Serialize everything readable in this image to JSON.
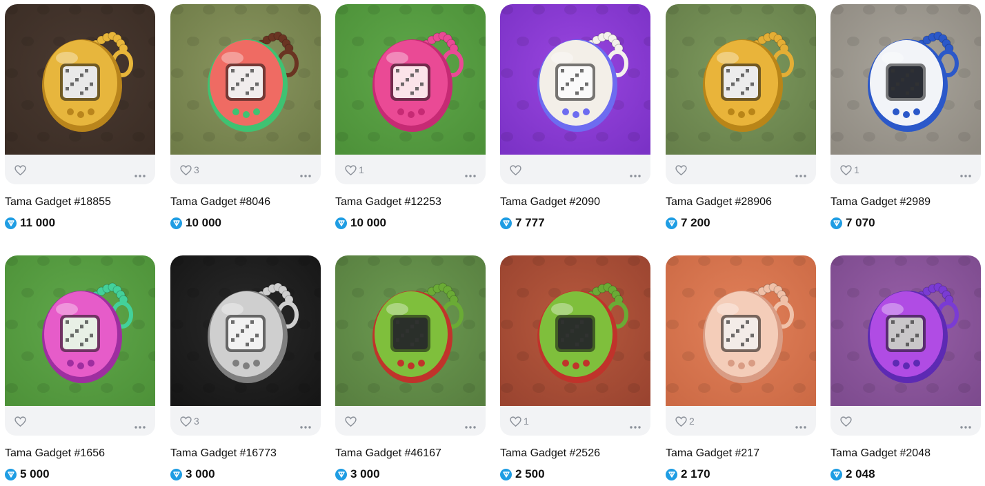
{
  "items": [
    {
      "title": "Tama Gadget #18855",
      "price": "11 000",
      "likes": "",
      "bg": "#4a3a31",
      "bg2": "#3b2d25",
      "body": "#e7b63d",
      "rim": "#b9851c",
      "screen": "#e9e9e9",
      "beads": "#e8b63a",
      "icon": "gadget-gold-icon"
    },
    {
      "title": "Tama Gadget #8046",
      "price": "10 000",
      "likes": "3",
      "bg": "#8a9660",
      "bg2": "#6f7c48",
      "body": "#ef6b63",
      "rim": "#3fc272",
      "screen": "#f1eded",
      "beads": "#6a3422",
      "icon": "gadget-red-green-icon"
    },
    {
      "title": "Tama Gadget #12253",
      "price": "10 000",
      "likes": "1",
      "bg": "#5fa84a",
      "bg2": "#4d9139",
      "body": "#ea4a95",
      "rim": "#c62a74",
      "screen": "#fbe3e9",
      "beads": "#ea4a95",
      "icon": "gadget-pink-heart-icon"
    },
    {
      "title": "Tama Gadget #2090",
      "price": "7 777",
      "likes": "",
      "bg": "#9a46e0",
      "bg2": "#7b32c6",
      "body": "#f3efe8",
      "rim": "#6d6cf0",
      "screen": "#fafafa",
      "beads": "#f4f1ec",
      "icon": "gadget-rainbow-icon"
    },
    {
      "title": "Tama Gadget #28906",
      "price": "7 200",
      "likes": "",
      "bg": "#7e9a5e",
      "bg2": "#667f4a",
      "body": "#e9b43a",
      "rim": "#b98518",
      "screen": "#ececec",
      "beads": "#e4ae35",
      "icon": "gadget-gold-icon"
    },
    {
      "title": "Tama Gadget #2989",
      "price": "7 070",
      "likes": "1",
      "bg": "#a9a59c",
      "bg2": "#908b82",
      "body": "#f2f4f8",
      "rim": "#2b58c9",
      "screen": "#2a2d35",
      "beads": "#2b58c9",
      "icon": "gadget-robot-icon"
    },
    {
      "title": "Tama Gadget #1656",
      "price": "5 000",
      "likes": "",
      "bg": "#60a84b",
      "bg2": "#4e9239",
      "body": "#e65cc9",
      "rim": "#9e2ea0",
      "screen": "#e8f0e6",
      "beads": "#43d19a",
      "icon": "gadget-pink-mint-icon"
    },
    {
      "title": "Tama Gadget #16773",
      "price": "3 000",
      "likes": "3",
      "bg": "#2a2a2a",
      "bg2": "#161616",
      "body": "#cfcfcf",
      "rim": "#7f7f7f",
      "screen": "#f2f2f2",
      "beads": "#cfcfcf",
      "icon": "gadget-silver-icon"
    },
    {
      "title": "Tama Gadget #46167",
      "price": "3 000",
      "likes": "",
      "bg": "#6d9c52",
      "bg2": "#587f40",
      "body": "#7fbf3c",
      "rim": "#c0332b",
      "screen": "#2a2f2a",
      "beads": "#6aab35",
      "icon": "gadget-frog-icon"
    },
    {
      "title": "Tama Gadget #2526",
      "price": "2 500",
      "likes": "1",
      "bg": "#b85a3e",
      "bg2": "#9a4430",
      "body": "#7fbf3c",
      "rim": "#c0332b",
      "screen": "#2a2f2a",
      "beads": "#6aab35",
      "icon": "gadget-frog-icon"
    },
    {
      "title": "Tama Gadget #217",
      "price": "2 170",
      "likes": "2",
      "bg": "#e2815a",
      "bg2": "#cc6a45",
      "body": "#f4cdb9",
      "rim": "#d99c84",
      "screen": "#f3ece8",
      "beads": "#f0c1a9",
      "icon": "gadget-peach-icon"
    },
    {
      "title": "Tama Gadget #2048",
      "price": "2 048",
      "likes": "",
      "bg": "#9860a8",
      "bg2": "#7d4b8e",
      "body": "#b04ce4",
      "rim": "#5d2ab3",
      "screen": "#c9c7c9",
      "beads": "#7a3bd4",
      "icon": "gadget-violet-icon"
    }
  ]
}
